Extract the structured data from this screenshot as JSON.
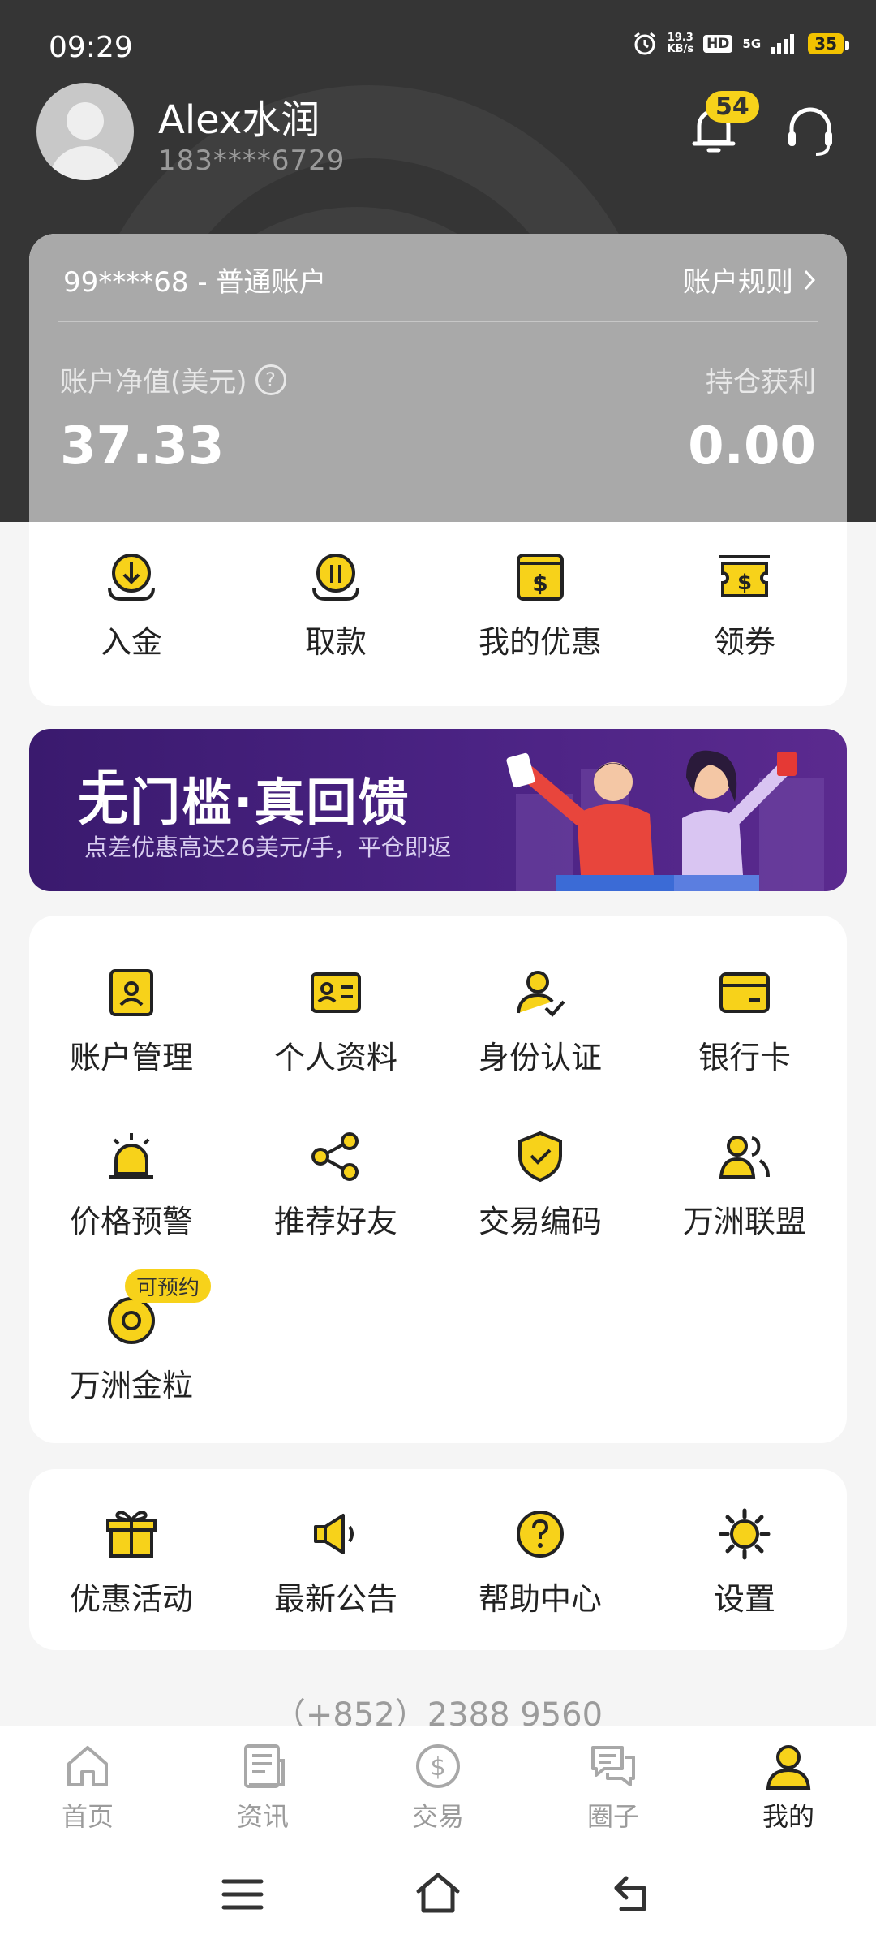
{
  "status_bar": {
    "time": "09:29",
    "speed_value": "19.3",
    "speed_unit": "KB/s",
    "hd": "HD",
    "network": "5G",
    "battery": "35"
  },
  "header": {
    "user_name": "Alex水润",
    "phone": "183****6729",
    "notification_count": "54"
  },
  "account": {
    "account_label": "99****68 - 普通账户",
    "rules_label": "账户规则",
    "equity_label": "账户净值(美元)",
    "equity_value": "37.33",
    "profit_label": "持仓获利",
    "profit_value": "0.00"
  },
  "quick_actions": [
    {
      "label": "入金",
      "icon": "deposit-icon"
    },
    {
      "label": "取款",
      "icon": "withdraw-icon"
    },
    {
      "label": "我的优惠",
      "icon": "my-offers-icon"
    },
    {
      "label": "领券",
      "icon": "coupon-icon"
    }
  ],
  "banner": {
    "title": "无门槛·真回馈",
    "subtitle": "点差优惠高达26美元/手，平仓即返"
  },
  "services": [
    {
      "label": "账户管理",
      "icon": "account-management-icon"
    },
    {
      "label": "个人资料",
      "icon": "profile-card-icon"
    },
    {
      "label": "身份认证",
      "icon": "identity-verify-icon"
    },
    {
      "label": "银行卡",
      "icon": "bank-card-icon"
    },
    {
      "label": "价格预警",
      "icon": "alarm-icon"
    },
    {
      "label": "推荐好友",
      "icon": "share-icon"
    },
    {
      "label": "交易编码",
      "icon": "shield-check-icon"
    },
    {
      "label": "万洲联盟",
      "icon": "alliance-icon"
    },
    {
      "label": "万洲金粒",
      "icon": "gold-coin-icon",
      "tag": "可预约"
    }
  ],
  "more": [
    {
      "label": "优惠活动",
      "icon": "gift-icon"
    },
    {
      "label": "最新公告",
      "icon": "megaphone-icon"
    },
    {
      "label": "帮助中心",
      "icon": "help-icon"
    },
    {
      "label": "设置",
      "icon": "settings-icon"
    }
  ],
  "contact_phone": "（+852）2388 9560",
  "tabs": [
    {
      "label": "首页",
      "icon": "home-icon"
    },
    {
      "label": "资讯",
      "icon": "news-icon"
    },
    {
      "label": "交易",
      "icon": "trade-icon"
    },
    {
      "label": "圈子",
      "icon": "chat-icon"
    },
    {
      "label": "我的",
      "icon": "me-icon",
      "active": true
    }
  ],
  "colors": {
    "accent": "#F7D21A",
    "header_bg": "#353535",
    "card_bg": "#A9A9A9",
    "page_bg": "#F5F5F5"
  }
}
